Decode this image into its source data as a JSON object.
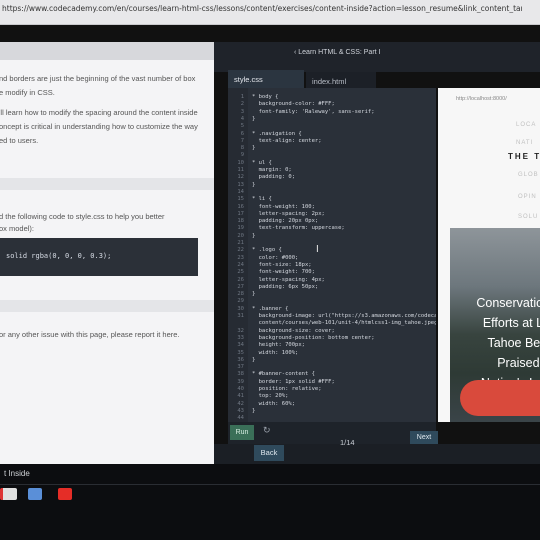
{
  "browser": {
    "url": "https://www.codecademy.com/en/courses/learn-html-css/lessons/content/exercises/content-inside?action=lesson_resume&link_content_target=interstitial_lesson"
  },
  "header": {
    "course_title": "‹ Learn HTML & CSS: Part I"
  },
  "instructions": {
    "lines": [
      "nd borders are just the beginning of the vast number of box",
      "e modify in CSS.",
      "'ll learn how to modify the spacing around the content inside",
      "oncept is critical in understanding how to customize the way",
      "ed to users."
    ],
    "step_lines": [
      "d the following code to style.css to help you better",
      "ox model):"
    ],
    "code_line": "solid rgba(0, 0, 0, 0.3);",
    "report_text": "or any other issue with this page, please report it here."
  },
  "editor": {
    "tabs": [
      "style.css",
      "index.html"
    ],
    "lines": [
      "* body {",
      "  background-color: #FFF;",
      "  font-family: 'Raleway', sans-serif;",
      "}",
      "",
      "* .navigation {",
      "  text-align: center;",
      "}",
      "",
      "* ul {",
      "  margin: 0;",
      "  padding: 0;",
      "}",
      "",
      "* li {",
      "  font-weight: 100;",
      "  letter-spacing: 2px;",
      "  padding: 20px 0px;",
      "  text-transform: uppercase;",
      "}",
      "",
      "* .logo {",
      "  color: #000;",
      "  font-size: 18px;",
      "  font-weight: 700;",
      "  letter-spacing: 4px;",
      "  padding: 6px 50px;",
      "}",
      "",
      "* .banner {",
      "  background-image: url(\"https://s3.amazonaws.com/codecademy-",
      "  content/courses/web-101/unit-4/htmlcss1-img_tahoe.jpeg\");",
      "  background-size: cover;",
      "  background-position: bottom center;",
      "  height: 700px;",
      "  width: 100%;",
      "}",
      "",
      "* #banner-content {",
      "  border: 1px solid #FFF;",
      "  position: relative;",
      "  top: 20%;",
      "  width: 60%;",
      "}",
      ""
    ],
    "line_numbers": [
      "1",
      "2",
      "3",
      "4",
      "5",
      "6",
      "7",
      "8",
      "9",
      "10",
      "11",
      "12",
      "13",
      "14",
      "15",
      "16",
      "17",
      "18",
      "19",
      "20",
      "21",
      "22",
      "23",
      "24",
      "25",
      "26",
      "27",
      "28",
      "29",
      "30",
      "31",
      "",
      "32",
      "33",
      "34",
      "35",
      "36",
      "37",
      "38",
      "39",
      "40",
      "41",
      "42",
      "43",
      "44"
    ]
  },
  "controls": {
    "run_label": "Run",
    "back_label": "Back",
    "next_label": "Next",
    "progress": "1/14"
  },
  "preview": {
    "url": "http://localhost:8000/",
    "nav_items": [
      "LOCA",
      "NATI",
      "GLOB",
      "OPIN",
      "SOLU"
    ],
    "logo": "THE TER",
    "headline": [
      "Conservation",
      "Efforts at La",
      "Tahoe Bein",
      "Praised b",
      "Nation's Lea"
    ]
  },
  "taskbar": {
    "label": "t Inside"
  }
}
